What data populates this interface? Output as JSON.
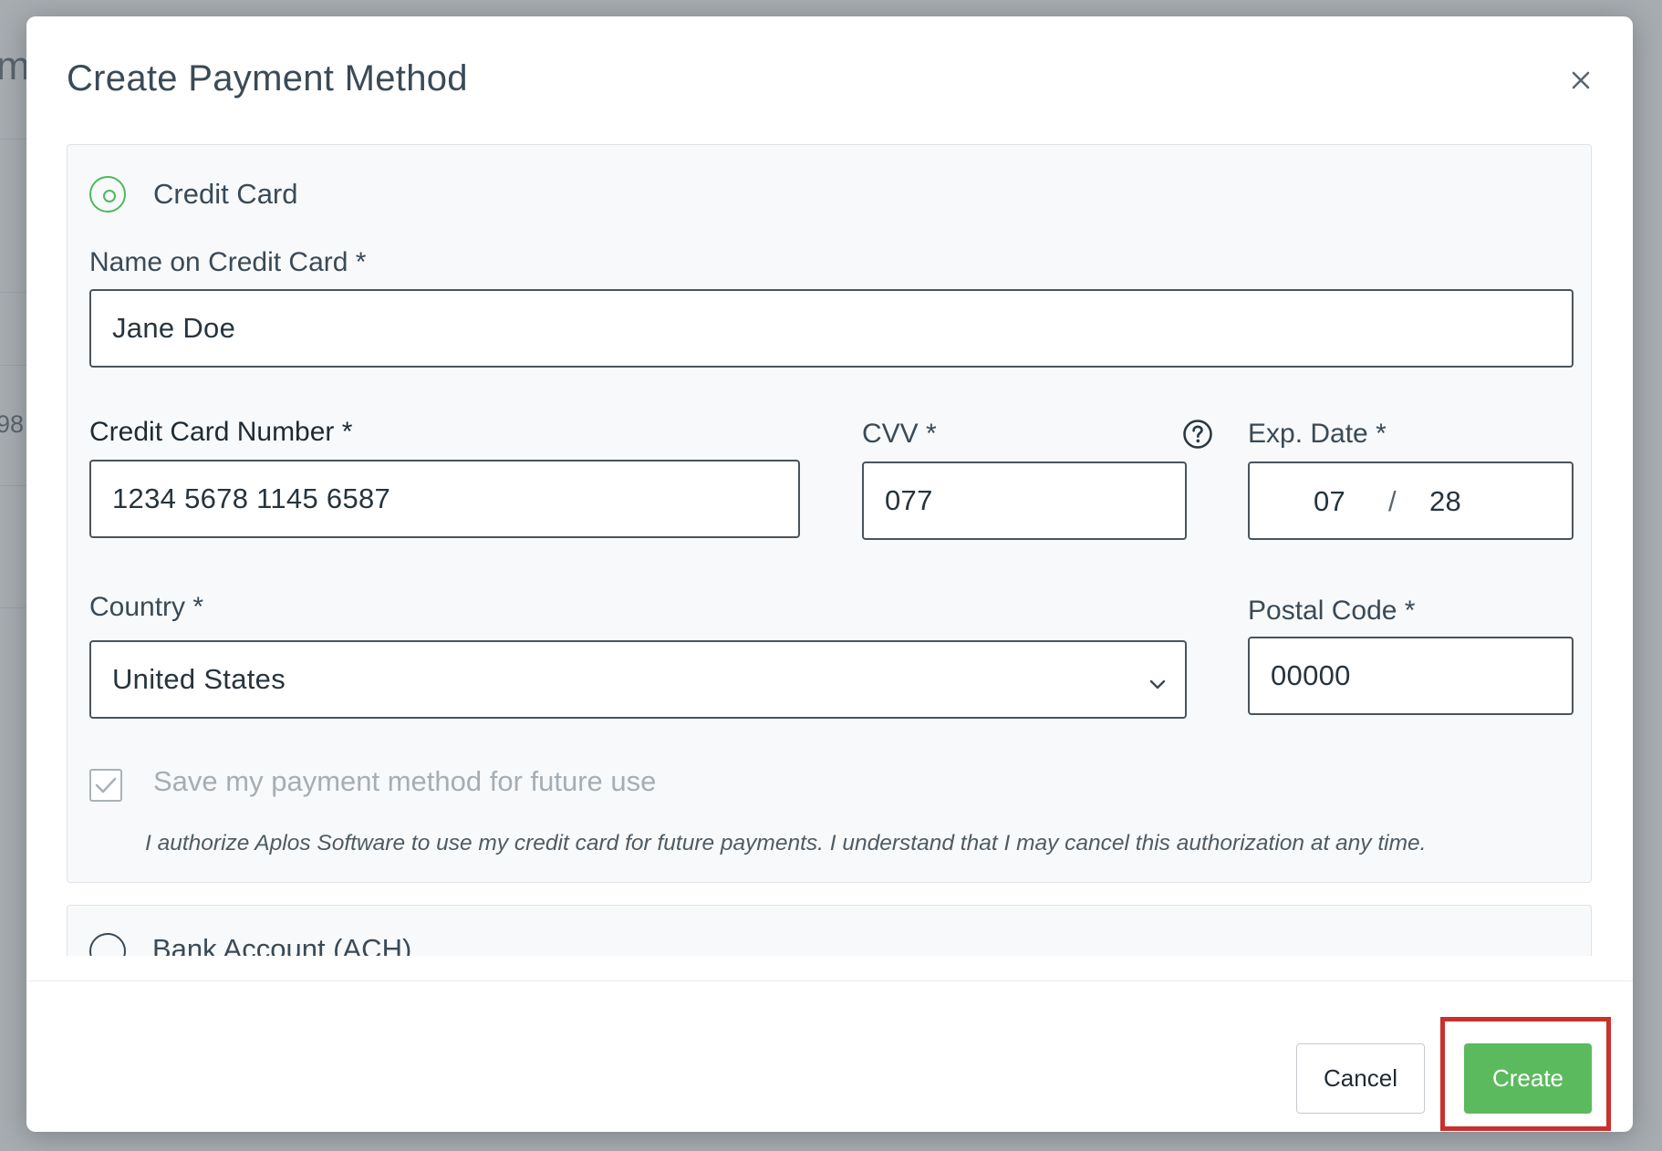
{
  "background": {
    "partial_heading": "m",
    "partial_number": "98"
  },
  "modal": {
    "title": "Create Payment Method",
    "close_icon": "close-icon"
  },
  "credit_card": {
    "option_label": "Credit Card",
    "selected": true,
    "name_label": "Name on Credit Card *",
    "name_value": "Jane Doe",
    "number_label": "Credit Card Number *",
    "number_value": "1234 5678 1145 6587",
    "cvv_label": "CVV *",
    "cvv_value": "077",
    "exp_label": "Exp. Date *",
    "exp_month": "07",
    "exp_separator": "/",
    "exp_year": "28",
    "country_label": "Country *",
    "country_value": "United States",
    "postal_label": "Postal Code *",
    "postal_value": "00000",
    "save_label": "Save my payment method for future use",
    "save_checked": true,
    "authorization_text": "I authorize Aplos Software to use my credit card for future payments. I understand that I may cancel this authorization at any time."
  },
  "second_option": {
    "label": "Bank Account (ACH)"
  },
  "footer": {
    "cancel_label": "Cancel",
    "create_label": "Create"
  },
  "colors": {
    "accent_green": "#5cba5e",
    "highlight_red": "#c9302c",
    "text_dark": "#3a4a56"
  }
}
